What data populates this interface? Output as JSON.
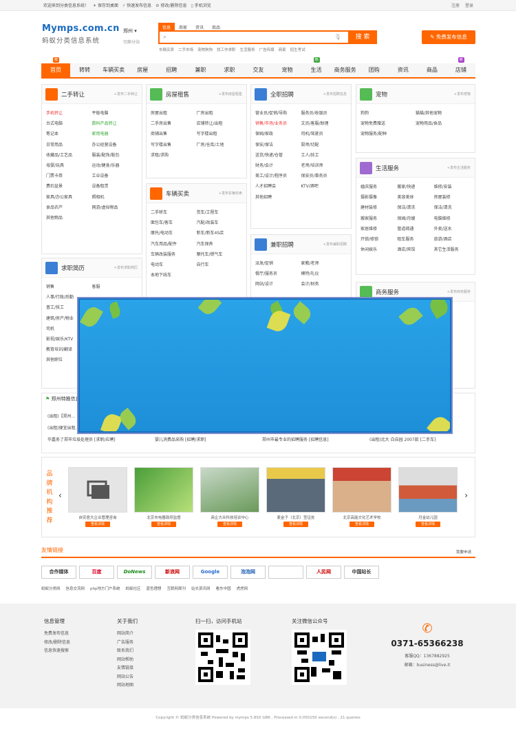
{
  "topbar": {
    "welcome": "欢迎来到分类信息系统！",
    "items": [
      "保存到桌面",
      "快速发布信息",
      "修改/删除信息",
      "手机浏览"
    ],
    "right": [
      "注册",
      "登录"
    ]
  },
  "logo": {
    "title": "Mymps.com.cn",
    "subtitle": "蚂蚁分类信息系统"
  },
  "city": {
    "name": "郑州",
    "switch": "切换分站"
  },
  "search": {
    "tabs": [
      "信息",
      "商家",
      "资讯",
      "商品"
    ],
    "button": "搜 索",
    "hot": [
      "车辆买卖",
      "二手市场",
      "宠物狗狗",
      "找工作求职",
      "生活服务",
      "广告传媒",
      "商家",
      "招生考试"
    ]
  },
  "free_post": "免费发布信息",
  "nav": [
    {
      "label": "首页",
      "active": true
    },
    {
      "label": "转转"
    },
    {
      "label": "车辆买卖"
    },
    {
      "label": "房屋"
    },
    {
      "label": "招聘"
    },
    {
      "label": "兼职"
    },
    {
      "label": "求职"
    },
    {
      "label": "交友"
    },
    {
      "label": "宠物"
    },
    {
      "label": "生活",
      "badge": "热"
    },
    {
      "label": "商务服务"
    },
    {
      "label": "团购"
    },
    {
      "label": "资讯"
    },
    {
      "label": "商品"
    },
    {
      "label": "店铺",
      "badge": "新"
    }
  ],
  "badges_first": "荐",
  "categories": {
    "used": {
      "title": "二手转让",
      "pub": "+发布二手转让",
      "items": [
        "手机转让",
        "平板电脑",
        "台式电脑",
        "数码产品转让",
        "笔记本",
        "家用电器",
        "日常用品",
        "办公经营设备",
        "收藏品/工艺品",
        "服装/配饰/鞋包",
        "母婴/玩具",
        "运动/健身/乐器",
        "门票卡券",
        "工业设备",
        "费石盆景",
        "设备租赁",
        "家具/办公家具",
        "照相机",
        "食品农产",
        "网游/虚拟物品",
        "其他物品"
      ]
    },
    "house": {
      "title": "房屋租售",
      "pub": "+发布房屋租售",
      "items": [
        "房屋出租",
        "厂房出租",
        "二手房出售",
        "店铺转让/出租",
        "商铺出售",
        "写字楼出租",
        "写字楼出售",
        "厂房/仓库/土地",
        "求租/求购"
      ]
    },
    "cars": {
      "title": "车辆买卖",
      "pub": "+发布车辆买卖",
      "items": [
        "二手轿车",
        "货车/工程车",
        "面包车/客车",
        "汽配/改装车",
        "摩托/电动车",
        "新车/新车4S店",
        "汽车用品/配件",
        "汽车保养",
        "车辆改装服务",
        "摩托车/燃气车",
        "电动车",
        "自行车",
        "本地下线车"
      ]
    },
    "jobs": {
      "title": "全职招聘",
      "pub": "+发布招聘信息",
      "items": [
        "营业员/促销/导购",
        "服务员/收银员",
        "销售/市场/业务员",
        "文员/客服/助理",
        "保姆/家政",
        "司机/驾驶员",
        "保安/保洁",
        "厨师/切配",
        "送货/快递/仓管",
        "工人/技工",
        "财务/会计",
        "老师/培训师",
        "美工/设计/程序员",
        "保安员/事务员",
        "人才招聘会",
        "KTV/酒吧",
        "其他招聘"
      ]
    },
    "parttime": {
      "title": "兼职招聘",
      "pub": "+发布兼职招聘",
      "items": [
        "派发/促销",
        "家教/老师",
        "餐厅/服务员",
        "模特/礼仪",
        "网站/设计",
        "会计/财务"
      ]
    },
    "resume": {
      "title": "求职简历",
      "pub": "+发布求职简历",
      "items": [
        "销售",
        "客服",
        "人事/行政/后勤",
        "",
        "普工/技工",
        "",
        "建筑/房产/物业",
        "",
        "司机",
        "",
        "影视/娱乐/KTV",
        "",
        "教育培训/翻译",
        "",
        "其他职位",
        ""
      ]
    },
    "pets": {
      "title": "宠物",
      "pub": "+发布宠物",
      "items": [
        "狗狗",
        "猫猫/其他宠物",
        "宠物免费赠送",
        "宠物用品/食品",
        "宠物服务/配种"
      ]
    },
    "life": {
      "title": "生活服务",
      "pub": "+发布生活服务",
      "items": [
        "婚庆服务",
        "搬家/快递",
        "维修/安装",
        "摄影摄像",
        "美容美体",
        "房屋装修",
        "建材装修",
        "保洁/清洗",
        "保洁/清洗",
        "搬家服务",
        "保姆/月嫂",
        "电脑维修",
        "家居维修",
        "管道疏通",
        "外卖/送水",
        "开锁/修锁",
        "租车服务",
        "旅游/酒店",
        "休闲娱乐",
        "酒店/宾馆",
        "其它生活服务"
      ]
    },
    "biz": {
      "title": "商务服务",
      "pub": "+发布商务服务"
    }
  },
  "news": {
    "title": "郑州特推信息",
    "rows": [
      [
        "(出租)【郑州...",
        "",
        "",
        ""
      ],
      [
        "(出租)便宜出租...",
        "",
        "",
        ""
      ],
      [
        "华嘉务了郑市垃圾处理员 [求职/应聘]",
        "婴儿消费品采购 [招聘/求职]",
        "郑州市最专业的招聘服务 [招聘信息]",
        "(出租)北大 白自园 2007款 [二手车]"
      ]
    ]
  },
  "brands": {
    "label": "品牌机构推荐",
    "items": [
      {
        "name": "自安居大企业管理咨询",
        "btn": "查看详情"
      },
      {
        "name": "北京市电器政府监督",
        "btn": "查看详情"
      },
      {
        "name": "商企大众科技培训中心",
        "btn": "查看详情"
      },
      {
        "name": "麦金子（北京）签证处",
        "btn": "查看详情"
      },
      {
        "name": "北京高能文化艺术学校",
        "btn": "查看详情"
      },
      {
        "name": "月金幼儿园",
        "btn": "查看详情"
      }
    ]
  },
  "links": {
    "title": "友情链接",
    "apply": "我要申请",
    "logos": [
      "合作媒体",
      "百度",
      "DoNews",
      "新浪网",
      "Google",
      "泡泡网",
      "",
      "人民网",
      "中国站长"
    ],
    "texts": [
      "蚂蚁分类网",
      "信息交流网",
      "php地方门户系统",
      "蚂蚁社区",
      "蓝色理想",
      "互联网周刊",
      "站长资讯网",
      "看东中国",
      "虎虎网"
    ]
  },
  "footer": {
    "col1": {
      "title": "信息管理",
      "items": [
        "免费发布信息",
        "修改/删除信息",
        "信息快速搜索"
      ]
    },
    "col2": {
      "title": "关于我们",
      "items": [
        "网站简介",
        "广告服务",
        "联系我们",
        "网站帮助",
        "友情链接",
        "网站公告",
        "网站地图"
      ]
    },
    "qr1": "扫一扫，访问手机站",
    "qr2": "关注微信公众号",
    "phone": "0371-65366238",
    "qq": "客服QQ：1367882925",
    "mail": "邮箱：business@live.it"
  },
  "copyright": "Copyright © 蚂蚁分类信息系统 Powered by mymps 5.8SX GBK , Processed in 0.050150 second(s) , 21 queries",
  "colors": {
    "accent": "#ff6600",
    "blue": "#1a6ac0"
  }
}
